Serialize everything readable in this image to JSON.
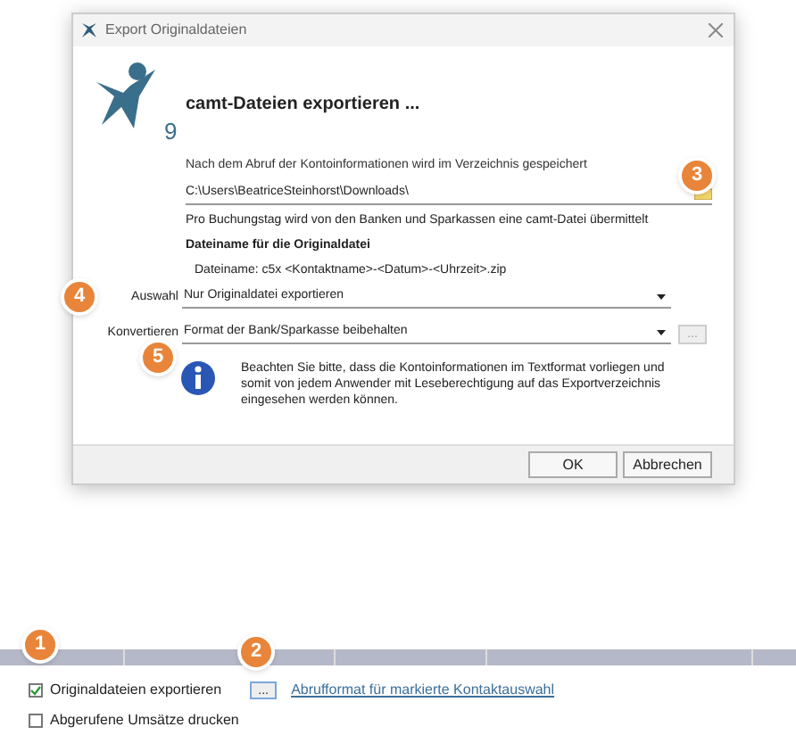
{
  "dialog": {
    "title": "Export Originaldateien",
    "logo_mark": "9",
    "heading": "camt-Dateien exportieren ...",
    "directory_label": "Nach dem Abruf der Kontoinformationen wird im Verzeichnis gespeichert",
    "directory_value": "C:\\Users\\BeatriceSteinhorst\\Downloads\\",
    "note": "Pro Buchungstag wird von den Banken und Sparkassen eine camt-Datei übermittelt",
    "filename_heading": "Dateiname für die Originaldatei",
    "filename": "Dateiname: c5x <Kontaktname>-<Datum>-<Uhrzeit>.zip",
    "selects": [
      {
        "label": "Auswahl",
        "value": "Nur Originaldatei exportieren"
      },
      {
        "label": "Konvertieren",
        "value": "Format der Bank/Sparkasse beibehalten",
        "more_label": "..."
      }
    ],
    "info": "Beachten Sie bitte, dass die Kontoinformationen im Textformat vorliegen und somit von jedem Anwender mit Leseberechtigung auf das Exportverzeichnis eingesehen werden können.",
    "buttons": [
      {
        "label": "OK"
      },
      {
        "label": "Abbrechen"
      }
    ]
  },
  "options": [
    {
      "label": "Originaldateien exportieren",
      "checked": true
    },
    {
      "label": "Abgerufene Umsätze drucken",
      "checked": false
    }
  ],
  "format_button": "...",
  "format_link": "Abrufformat für markierte Kontaktauswahl",
  "badges": [
    {
      "number": "1"
    },
    {
      "number": "2"
    },
    {
      "number": "3"
    },
    {
      "number": "4"
    },
    {
      "number": "5"
    }
  ]
}
